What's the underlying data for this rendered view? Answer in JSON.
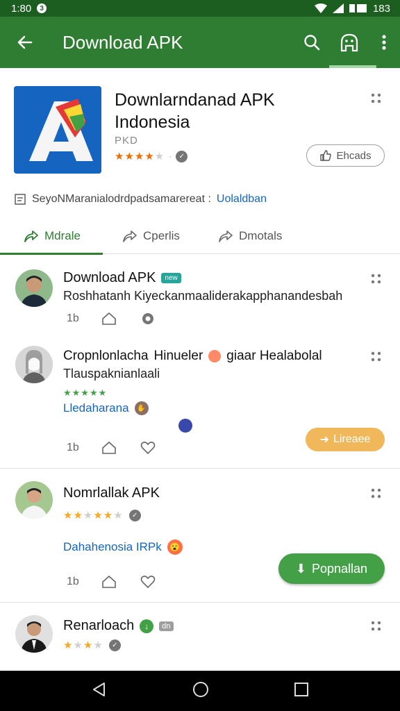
{
  "status": {
    "time": "1:80",
    "notif": "3",
    "right": "183"
  },
  "appbar": {
    "title": "Download APK"
  },
  "app": {
    "name": "Downlarndanad APK Indonesia",
    "dev": "PKD",
    "rating": 4,
    "button": "Ehcads",
    "desc": "SeyoNMaranialodrdpadsamarereat :",
    "desc_link": "Uolaldban"
  },
  "tabs": [
    {
      "label": "Mdrale"
    },
    {
      "label": "Cperlis"
    },
    {
      "label": "Dmotals"
    }
  ],
  "posts": [
    {
      "title": "Download APK",
      "tag": "new",
      "text": "Roshhatanh Kiyeckanmaaliderakaрphanandesbah",
      "likes": "1b"
    },
    {
      "title": "Cropnlonlacha",
      "title_extra": "Hinueler",
      "title_extra2": "giaar Healabolal",
      "text": "Tlauspaknianlaali",
      "link": "Lledaharana",
      "likes": "1b",
      "button": "Lireaee"
    },
    {
      "title": "Nomrlallak APK",
      "link": "Dahahenosia IRPk",
      "likes": "1b",
      "button": "Popnallan"
    },
    {
      "title": "Renarloach",
      "tag": "dn"
    }
  ],
  "colors": {
    "primary": "#2e7d32",
    "status": "#1b5e20",
    "accent": "#43a047",
    "link": "#1565c0",
    "amber": "#f0b85a"
  }
}
